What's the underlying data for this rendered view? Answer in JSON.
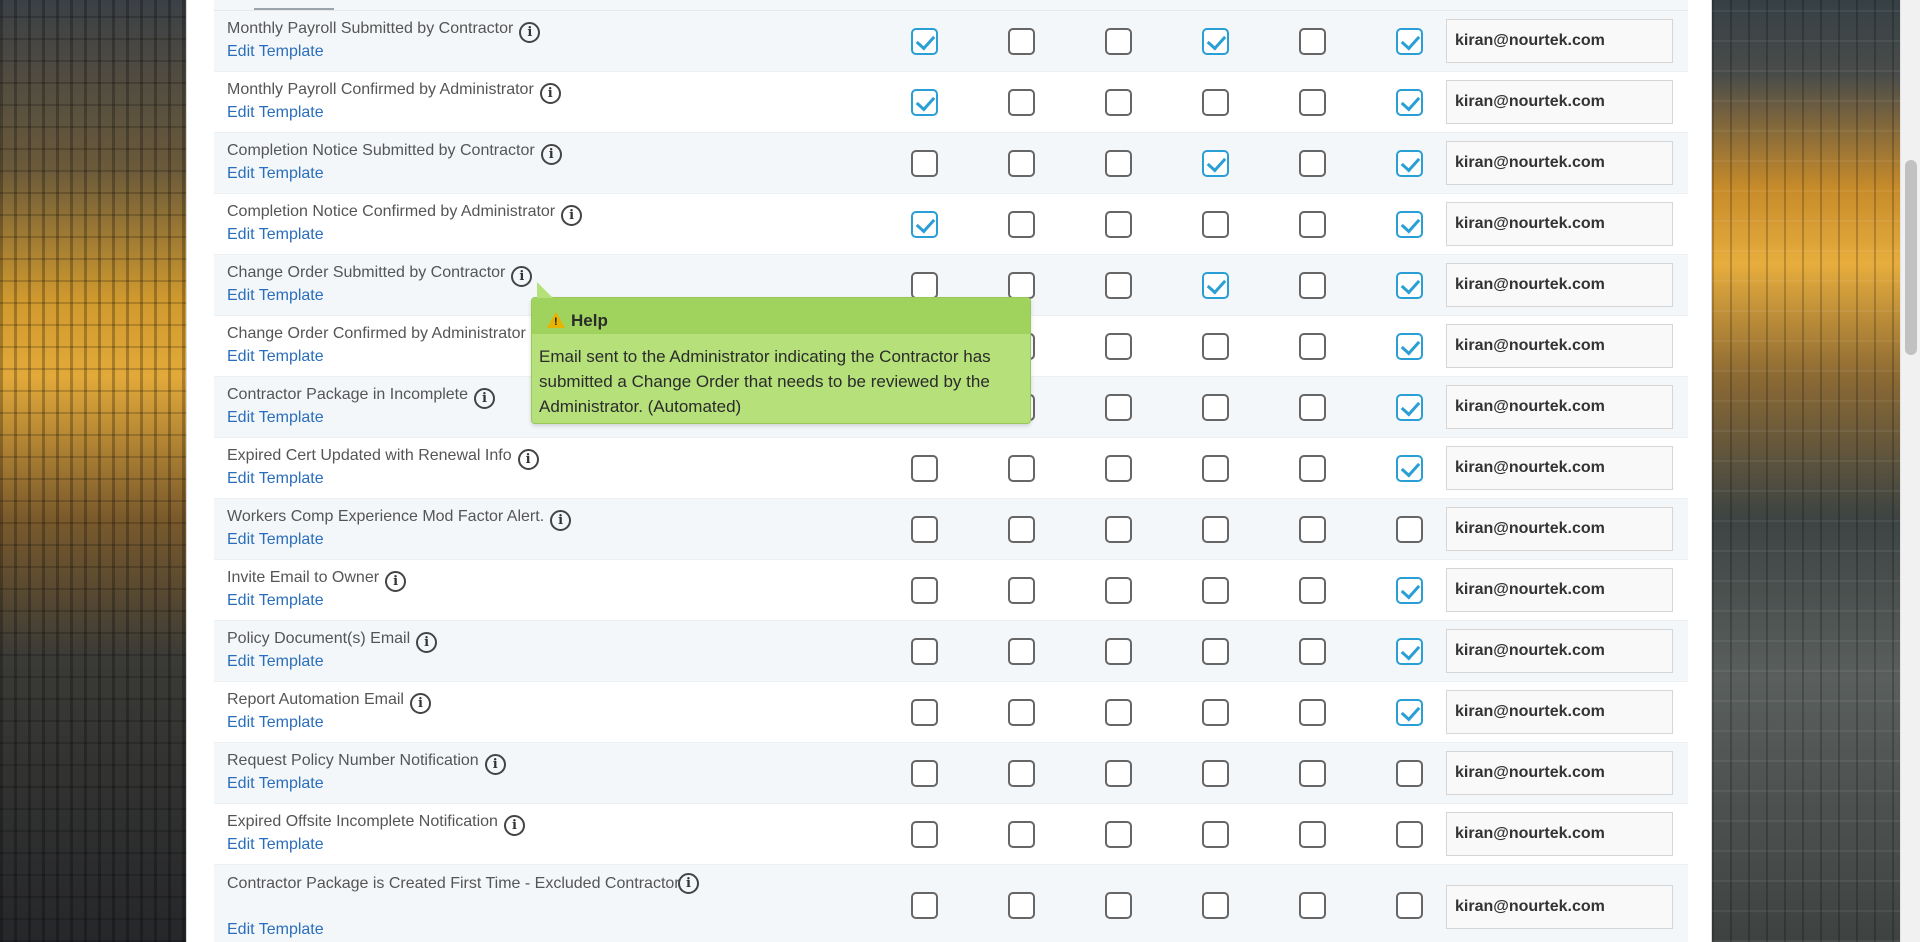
{
  "template_link_label": "Edit Template",
  "rows": [
    {
      "name": "Monthly Payroll Submitted by Contractor",
      "checks": [
        true,
        false,
        false,
        true,
        false,
        true
      ],
      "email": "kiran@nourtek.com"
    },
    {
      "name": "Monthly Payroll Confirmed by Administrator",
      "checks": [
        true,
        false,
        false,
        false,
        false,
        true
      ],
      "email": "kiran@nourtek.com"
    },
    {
      "name": "Completion Notice Submitted by Contractor",
      "checks": [
        false,
        false,
        false,
        true,
        false,
        true
      ],
      "email": "kiran@nourtek.com"
    },
    {
      "name": "Completion Notice Confirmed by Administrator",
      "checks": [
        true,
        false,
        false,
        false,
        false,
        true
      ],
      "email": "kiran@nourtek.com"
    },
    {
      "name": "Change Order Submitted by Contractor",
      "checks": [
        false,
        false,
        false,
        true,
        false,
        true
      ],
      "email": "kiran@nourtek.com"
    },
    {
      "name": "Change Order Confirmed by Administrator",
      "checks": [
        false,
        false,
        false,
        false,
        false,
        true
      ],
      "email": "kiran@nourtek.com"
    },
    {
      "name": "Contractor Package in Incomplete",
      "checks": [
        false,
        false,
        false,
        false,
        false,
        true
      ],
      "email": "kiran@nourtek.com"
    },
    {
      "name": "Expired Cert Updated with Renewal Info",
      "checks": [
        false,
        false,
        false,
        false,
        false,
        true
      ],
      "email": "kiran@nourtek.com"
    },
    {
      "name": "Workers Comp Experience Mod Factor Alert.",
      "checks": [
        false,
        false,
        false,
        false,
        false,
        false
      ],
      "email": "kiran@nourtek.com"
    },
    {
      "name": "Invite Email to Owner",
      "checks": [
        false,
        false,
        false,
        false,
        false,
        true
      ],
      "email": "kiran@nourtek.com"
    },
    {
      "name": "Policy Document(s) Email",
      "checks": [
        false,
        false,
        false,
        false,
        false,
        true
      ],
      "email": "kiran@nourtek.com"
    },
    {
      "name": "Report Automation Email",
      "checks": [
        false,
        false,
        false,
        false,
        false,
        true
      ],
      "email": "kiran@nourtek.com"
    },
    {
      "name": "Request Policy Number Notification",
      "checks": [
        false,
        false,
        false,
        false,
        false,
        false
      ],
      "email": "kiran@nourtek.com"
    },
    {
      "name": "Expired Offsite Incomplete Notification",
      "checks": [
        false,
        false,
        false,
        false,
        false,
        false
      ],
      "email": "kiran@nourtek.com"
    },
    {
      "name": "Contractor Package is Created First Time - Excluded Contractor",
      "checks": [
        false,
        false,
        false,
        false,
        false,
        false
      ],
      "email": "kiran@nourtek.com"
    }
  ],
  "tooltip": {
    "title": "Help",
    "body": "Email sent to the Administrator indicating the Contractor has submitted a Change Order that needs to be reviewed by the Administrator. (Automated)"
  },
  "colors": {
    "checked": "#2a9fd6",
    "link": "#2a6ebb",
    "tooltip_bg": "#b5e07a"
  }
}
